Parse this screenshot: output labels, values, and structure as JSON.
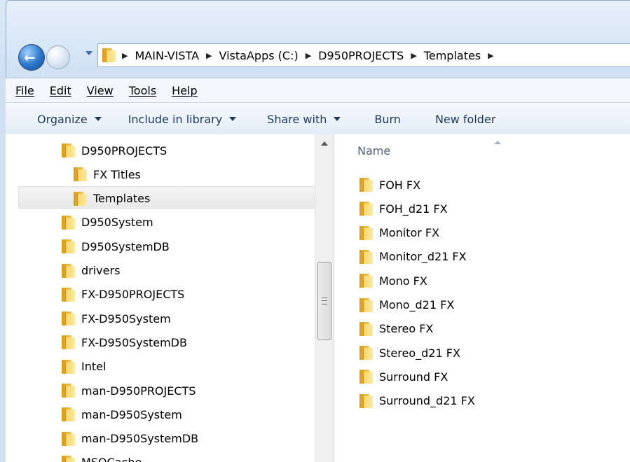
{
  "address_bar": {
    "breadcrumbs": [
      "MAIN-VISTA",
      "VistaApps (C:)",
      "D950PROJECTS",
      "Templates"
    ]
  },
  "menu": [
    "File",
    "Edit",
    "View",
    "Tools",
    "Help"
  ],
  "toolbar": {
    "organize": "Organize",
    "include_in_library": "Include in library",
    "share_with": "Share with",
    "burn": "Burn",
    "new_folder": "New folder"
  },
  "nav_tree": {
    "items": [
      {
        "label": "D950PROJECTS"
      },
      {
        "label": "FX Titles"
      },
      {
        "label": "Templates",
        "selected": true
      },
      {
        "label": "D950System"
      },
      {
        "label": "D950SystemDB"
      },
      {
        "label": "drivers"
      },
      {
        "label": "FX-D950PROJECTS"
      },
      {
        "label": "FX-D950System"
      },
      {
        "label": "FX-D950SystemDB"
      },
      {
        "label": "Intel"
      },
      {
        "label": "man-D950PROJECTS"
      },
      {
        "label": "man-D950System"
      },
      {
        "label": "man-D950SystemDB"
      },
      {
        "label": "MSOCache"
      }
    ]
  },
  "content": {
    "column_header": "Name",
    "files": [
      {
        "name": "FOH FX"
      },
      {
        "name": "FOH_d21 FX"
      },
      {
        "name": "Monitor FX"
      },
      {
        "name": "Monitor_d21 FX"
      },
      {
        "name": "Mono FX"
      },
      {
        "name": "Mono_d21 FX"
      },
      {
        "name": "Stereo FX"
      },
      {
        "name": "Stereo_d21 FX"
      },
      {
        "name": "Surround FX"
      },
      {
        "name": "Surround_d21 FX"
      }
    ]
  },
  "icons": {
    "folder": "folder-icon",
    "back": "back-arrow-icon",
    "forward": "forward-arrow-icon",
    "breadcrumb_separator": "chevron-right-icon"
  },
  "colors": {
    "toolbar_text": "#1e395b",
    "header_text": "#4c607a",
    "selection": "#e8e8e8"
  }
}
